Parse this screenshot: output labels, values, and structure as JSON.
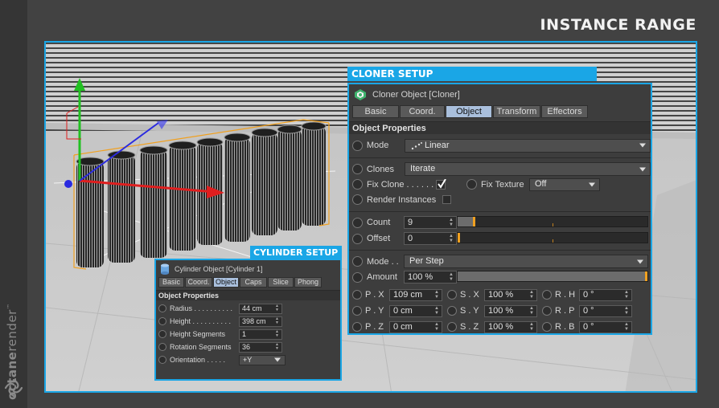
{
  "heading": "INSTANCE RANGE",
  "side_logo": {
    "brand_bold": "octane",
    "brand_light": "render",
    "tm": "™"
  },
  "cloner": {
    "tag": "CLONER SETUP",
    "title": "Cloner Object [Cloner]",
    "tabs": [
      {
        "label": "Basic",
        "active": false
      },
      {
        "label": "Coord.",
        "active": false
      },
      {
        "label": "Object",
        "active": true
      },
      {
        "label": "Transform",
        "active": false
      },
      {
        "label": "Effectors",
        "active": false
      }
    ],
    "section": "Object Properties",
    "mode_label": "Mode",
    "mode_value": "Linear",
    "clones_label": "Clones",
    "clones_value": "Iterate",
    "fix_clone_label": "Fix Clone . . . . . .",
    "fix_clone_checked": true,
    "fix_texture_label": "Fix Texture",
    "fix_texture_value": "Off",
    "render_instances_label": "Render Instances",
    "render_instances_checked": false,
    "count_label": "Count",
    "count_value": "9",
    "count_slider": 0.09,
    "offset_label": "Offset",
    "offset_value": "0",
    "offset_slider": 0.0,
    "mode2_label": "Mode . .",
    "mode2_value": "Per Step",
    "amount_label": "Amount",
    "amount_value": "100 %",
    "amount_slider": 1.0,
    "transform_rows": [
      [
        {
          "label": "P . X",
          "value": "109 cm"
        },
        {
          "label": "S . X",
          "value": "100 %"
        },
        {
          "label": "R . H",
          "value": "0 °"
        }
      ],
      [
        {
          "label": "P . Y",
          "value": "0 cm"
        },
        {
          "label": "S . Y",
          "value": "100 %"
        },
        {
          "label": "R . P",
          "value": "0 °"
        }
      ],
      [
        {
          "label": "P . Z",
          "value": "0 cm"
        },
        {
          "label": "S . Z",
          "value": "100 %"
        },
        {
          "label": "R . B",
          "value": "0 °"
        }
      ]
    ]
  },
  "cylinder": {
    "tag": "CYLINDER SETUP",
    "title": "Cylinder Object [Cylinder 1]",
    "tabs": [
      {
        "label": "Basic",
        "active": false
      },
      {
        "label": "Coord.",
        "active": false
      },
      {
        "label": "Object",
        "active": true
      },
      {
        "label": "Caps",
        "active": false
      },
      {
        "label": "Slice",
        "active": false
      },
      {
        "label": "Phong",
        "active": false
      }
    ],
    "section": "Object Properties",
    "props": [
      {
        "label": "Radius . . . . . . . . . .",
        "value": "44 cm",
        "kind": "spin"
      },
      {
        "label": "Height . . . . . . . . . .",
        "value": "398 cm",
        "kind": "spin"
      },
      {
        "label": "Height Segments",
        "value": "1",
        "kind": "spin"
      },
      {
        "label": "Rotation Segments",
        "value": "36",
        "kind": "spin"
      },
      {
        "label": "Orientation . . . . .",
        "value": "+Y",
        "kind": "dropdown"
      }
    ]
  },
  "colors": {
    "accent": "#1aa6e6",
    "slider_knob": "#f0a020",
    "selection": "#f0a020"
  },
  "icons": [
    "cloner-icon",
    "cylinder-icon",
    "octane-logo-icon",
    "axis-gizmo-icon"
  ]
}
